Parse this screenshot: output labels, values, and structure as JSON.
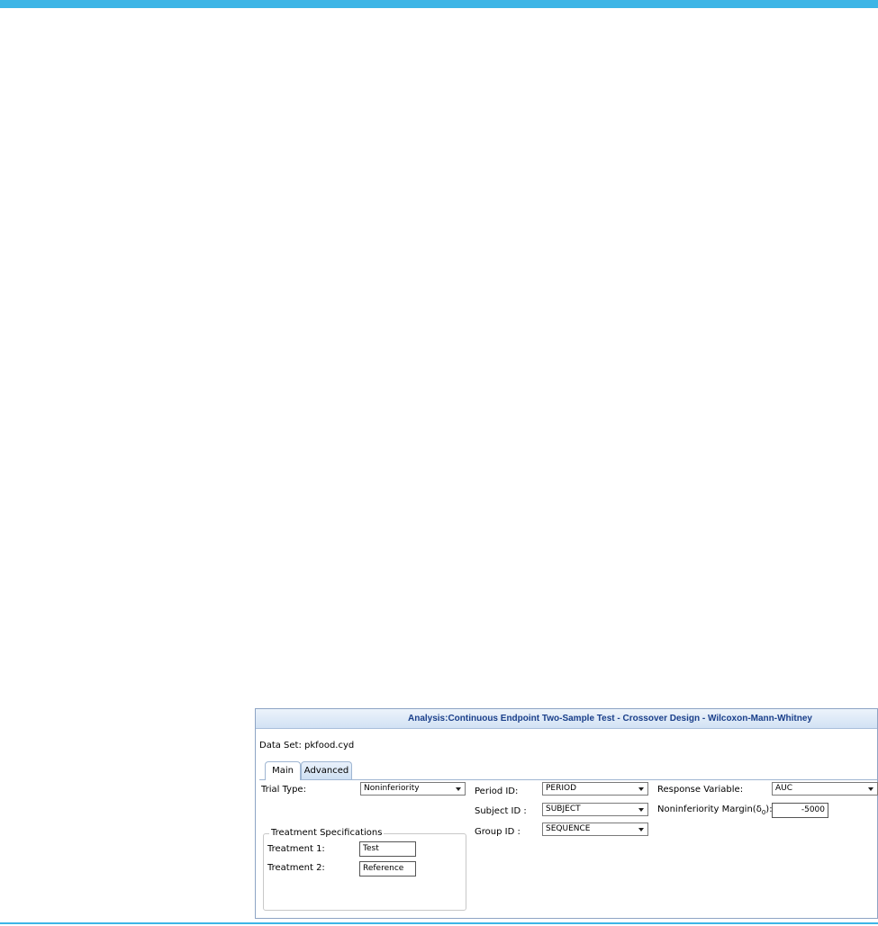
{
  "dialog": {
    "title": "Analysis:Continuous Endpoint Two-Sample Test - Crossover Design - Wilcoxon-Mann-Whitney",
    "dataset_label": "Data Set:",
    "dataset_value": "pkfood.cyd"
  },
  "tabs": [
    {
      "label": "Main",
      "active": true
    },
    {
      "label": "Advanced",
      "active": false
    }
  ],
  "form": {
    "trial_type_label": "Trial Type:",
    "trial_type_value": "Noninferiority",
    "treatment_specs_legend": "Treatment Specifications",
    "treatment1_label": "Treatment 1:",
    "treatment1_value": "Test",
    "treatment2_label": "Treatment 2:",
    "treatment2_value": "Reference",
    "period_id_label": "Period ID:",
    "period_id_value": "PERIOD",
    "subject_id_label": "Subject ID :",
    "subject_id_value": "SUBJECT",
    "group_id_label": "Group ID :",
    "group_id_value": "SEQUENCE",
    "response_variable_label": "Response Variable:",
    "response_variable_value": "AUC",
    "ni_margin_label_prefix": "Noninferiority Margin(δ",
    "ni_margin_label_sub": "0",
    "ni_margin_label_suffix": "):",
    "ni_margin_value": "-5000"
  },
  "colors": {
    "accent_bar": "#3db5e6",
    "title_text": "#1a3f8a"
  }
}
